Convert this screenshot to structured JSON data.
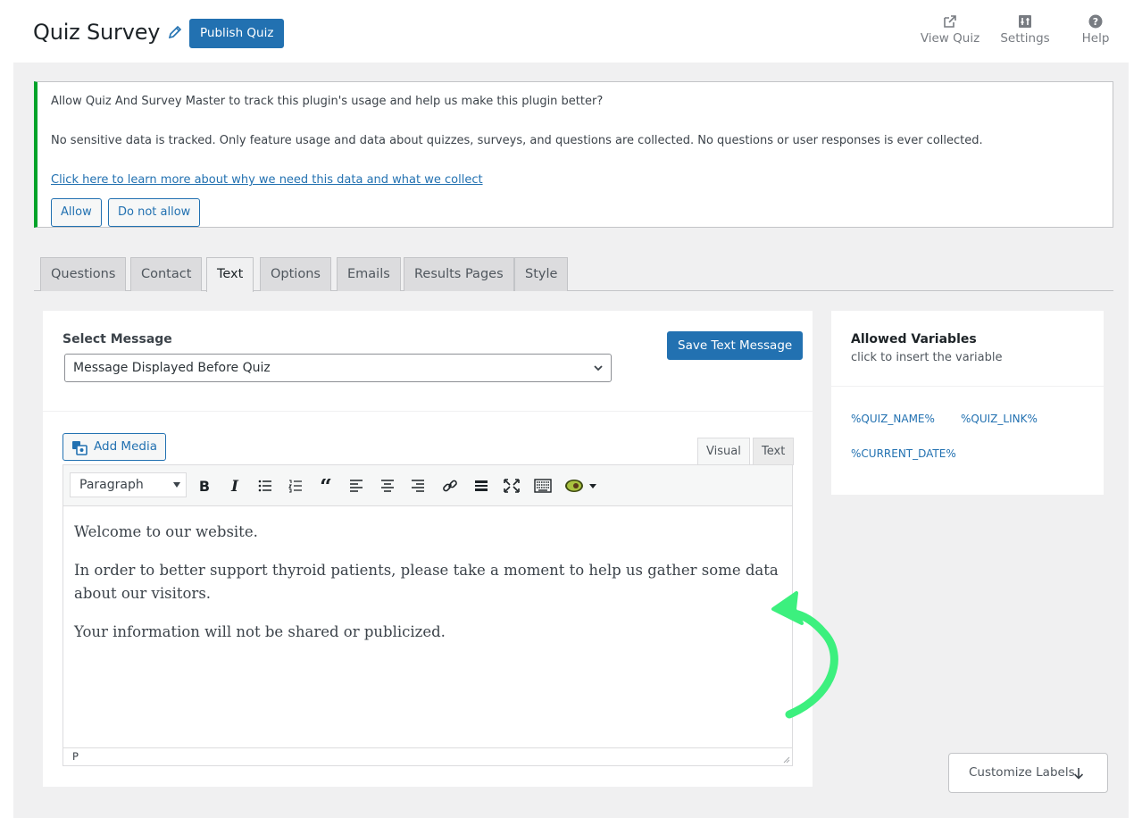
{
  "header": {
    "title": "Quiz Survey",
    "publish_label": "Publish Quiz",
    "actions": [
      {
        "label": "View Quiz",
        "icon": "external-link-icon"
      },
      {
        "label": "Settings",
        "icon": "settings-sliders-icon"
      },
      {
        "label": "Help",
        "icon": "help-circle-icon"
      }
    ]
  },
  "notice": {
    "line1": "Allow Quiz And Survey Master to track this plugin's usage and help us make this plugin better?",
    "line2": "No sensitive data is tracked. Only feature usage and data about quizzes, surveys, and questions are collected. No questions or user responses is ever collected.",
    "link": "Click here to learn more about why we need this data and what we collect",
    "allow_label": "Allow",
    "deny_label": "Do not allow",
    "accent_color": "#00a32a"
  },
  "tabs": [
    {
      "label": "Questions",
      "active": false
    },
    {
      "label": "Contact",
      "active": false
    },
    {
      "label": "Text",
      "active": true
    },
    {
      "label": "Options",
      "active": false
    },
    {
      "label": "Emails",
      "active": false
    },
    {
      "label": "Results Pages",
      "active": false
    },
    {
      "label": "Style",
      "active": false
    }
  ],
  "message_panel": {
    "select_label": "Select Message",
    "selected_value": "Message Displayed Before Quiz",
    "save_label": "Save Text Message"
  },
  "editor": {
    "add_media_label": "Add Media",
    "visual_tab": "Visual",
    "text_tab": "Text",
    "format_value": "Paragraph",
    "paragraphs": [
      "Welcome to our website.",
      "In order to better support thyroid patients, please take a moment to help us gather some data about our visitors.",
      "Your information will not be shared or publicized."
    ],
    "status_path": "P",
    "toolbar_icons": [
      "bold-icon",
      "italic-icon",
      "bullet-list-icon",
      "numbered-list-icon",
      "blockquote-icon",
      "align-left-icon",
      "align-center-icon",
      "align-right-icon",
      "link-icon",
      "horizontal-line-icon",
      "fullscreen-icon",
      "keyboard-toolbar-icon",
      "avocado-plugin-icon"
    ]
  },
  "variables": {
    "title": "Allowed Variables",
    "subtitle": "click to insert the variable",
    "items": [
      "%QUIZ_NAME%",
      "%QUIZ_LINK%",
      "%CURRENT_DATE%"
    ]
  },
  "customize_label": "Customize Labels",
  "colors": {
    "primary": "#2271b1",
    "annotation": "#3cf07e"
  }
}
